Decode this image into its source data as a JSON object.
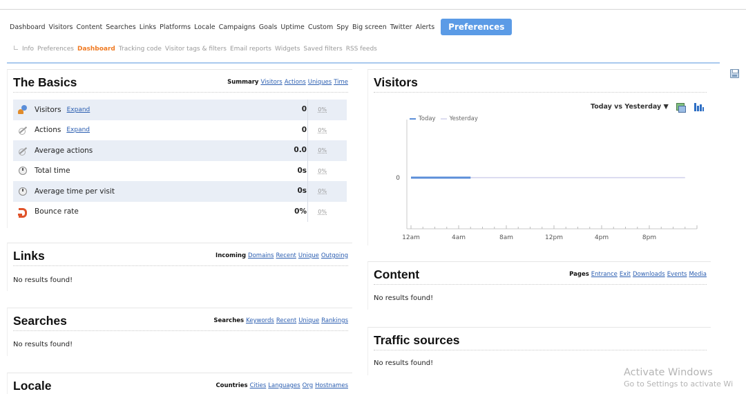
{
  "main_nav": [
    "Dashboard",
    "Visitors",
    "Content",
    "Searches",
    "Links",
    "Platforms",
    "Locale",
    "Campaigns",
    "Goals",
    "Uptime",
    "Custom",
    "Spy",
    "Big screen",
    "Twitter",
    "Alerts",
    "Preferences"
  ],
  "active_main_nav": "Preferences",
  "sub_nav": [
    "Info",
    "Preferences",
    "Dashboard",
    "Tracking code",
    "Visitor tags & filters",
    "Email reports",
    "Widgets",
    "Saved filters",
    "RSS feeds"
  ],
  "active_sub_nav": "Dashboard",
  "basics": {
    "title": "The Basics",
    "tabs": [
      "Summary",
      "Visitors",
      "Actions",
      "Uniques",
      "Time"
    ],
    "rows": [
      {
        "label": "Visitors",
        "expand": "Expand",
        "value": "0",
        "pct": "0%",
        "icon": "visitors-icon"
      },
      {
        "label": "Actions",
        "expand": "Expand",
        "value": "0",
        "pct": "0%",
        "icon": "actions-icon"
      },
      {
        "label": "Average actions",
        "expand": "",
        "value": "0.0",
        "pct": "0%",
        "icon": "average-actions-icon"
      },
      {
        "label": "Total time",
        "expand": "",
        "value": "0s",
        "pct": "0%",
        "icon": "clock-icon"
      },
      {
        "label": "Average time per visit",
        "expand": "",
        "value": "0s",
        "pct": "0%",
        "icon": "clock-icon"
      },
      {
        "label": "Bounce rate",
        "expand": "",
        "value": "0%",
        "pct": "0%",
        "icon": "bounce-icon"
      }
    ]
  },
  "links": {
    "title": "Links",
    "tabs": [
      "Incoming",
      "Domains",
      "Recent",
      "Unique",
      "Outgoing"
    ],
    "empty": "No results found!"
  },
  "searches": {
    "title": "Searches",
    "tabs": [
      "Searches",
      "Keywords",
      "Recent",
      "Unique",
      "Rankings"
    ],
    "empty": "No results found!"
  },
  "locale": {
    "title": "Locale",
    "tabs": [
      "Countries",
      "Cities",
      "Languages",
      "Org",
      "Hostnames"
    ]
  },
  "visitors_panel": {
    "title": "Visitors",
    "range_label": "Today vs Yesterday ▼"
  },
  "content": {
    "title": "Content",
    "tabs": [
      "Pages",
      "Entrance",
      "Exit",
      "Downloads",
      "Events",
      "Media"
    ],
    "empty": "No results found!"
  },
  "traffic": {
    "title": "Traffic sources",
    "empty": "No results found!"
  },
  "watermark": {
    "line1": "Activate Windows",
    "line2": "Go to Settings to activate Wi"
  },
  "chart_data": {
    "type": "line",
    "x_tick_labels": [
      "12am",
      "4am",
      "8am",
      "12pm",
      "4pm",
      "8pm"
    ],
    "y_tick_labels": [
      "0"
    ],
    "series": [
      {
        "name": "Today",
        "color": "#5b8ed8",
        "x": [
          0,
          5
        ],
        "y": [
          0,
          0
        ]
      },
      {
        "name": "Yesterday",
        "color": "#dcdcf0",
        "x": [
          0,
          23
        ],
        "y": [
          0,
          0
        ]
      }
    ],
    "xlim": [
      0,
      24
    ],
    "legend": "top-left"
  },
  "colors": {
    "accent": "#5b9be6",
    "active_sub": "#f07a22",
    "link": "#2a5db0",
    "row_shade": "#e9eef6"
  }
}
